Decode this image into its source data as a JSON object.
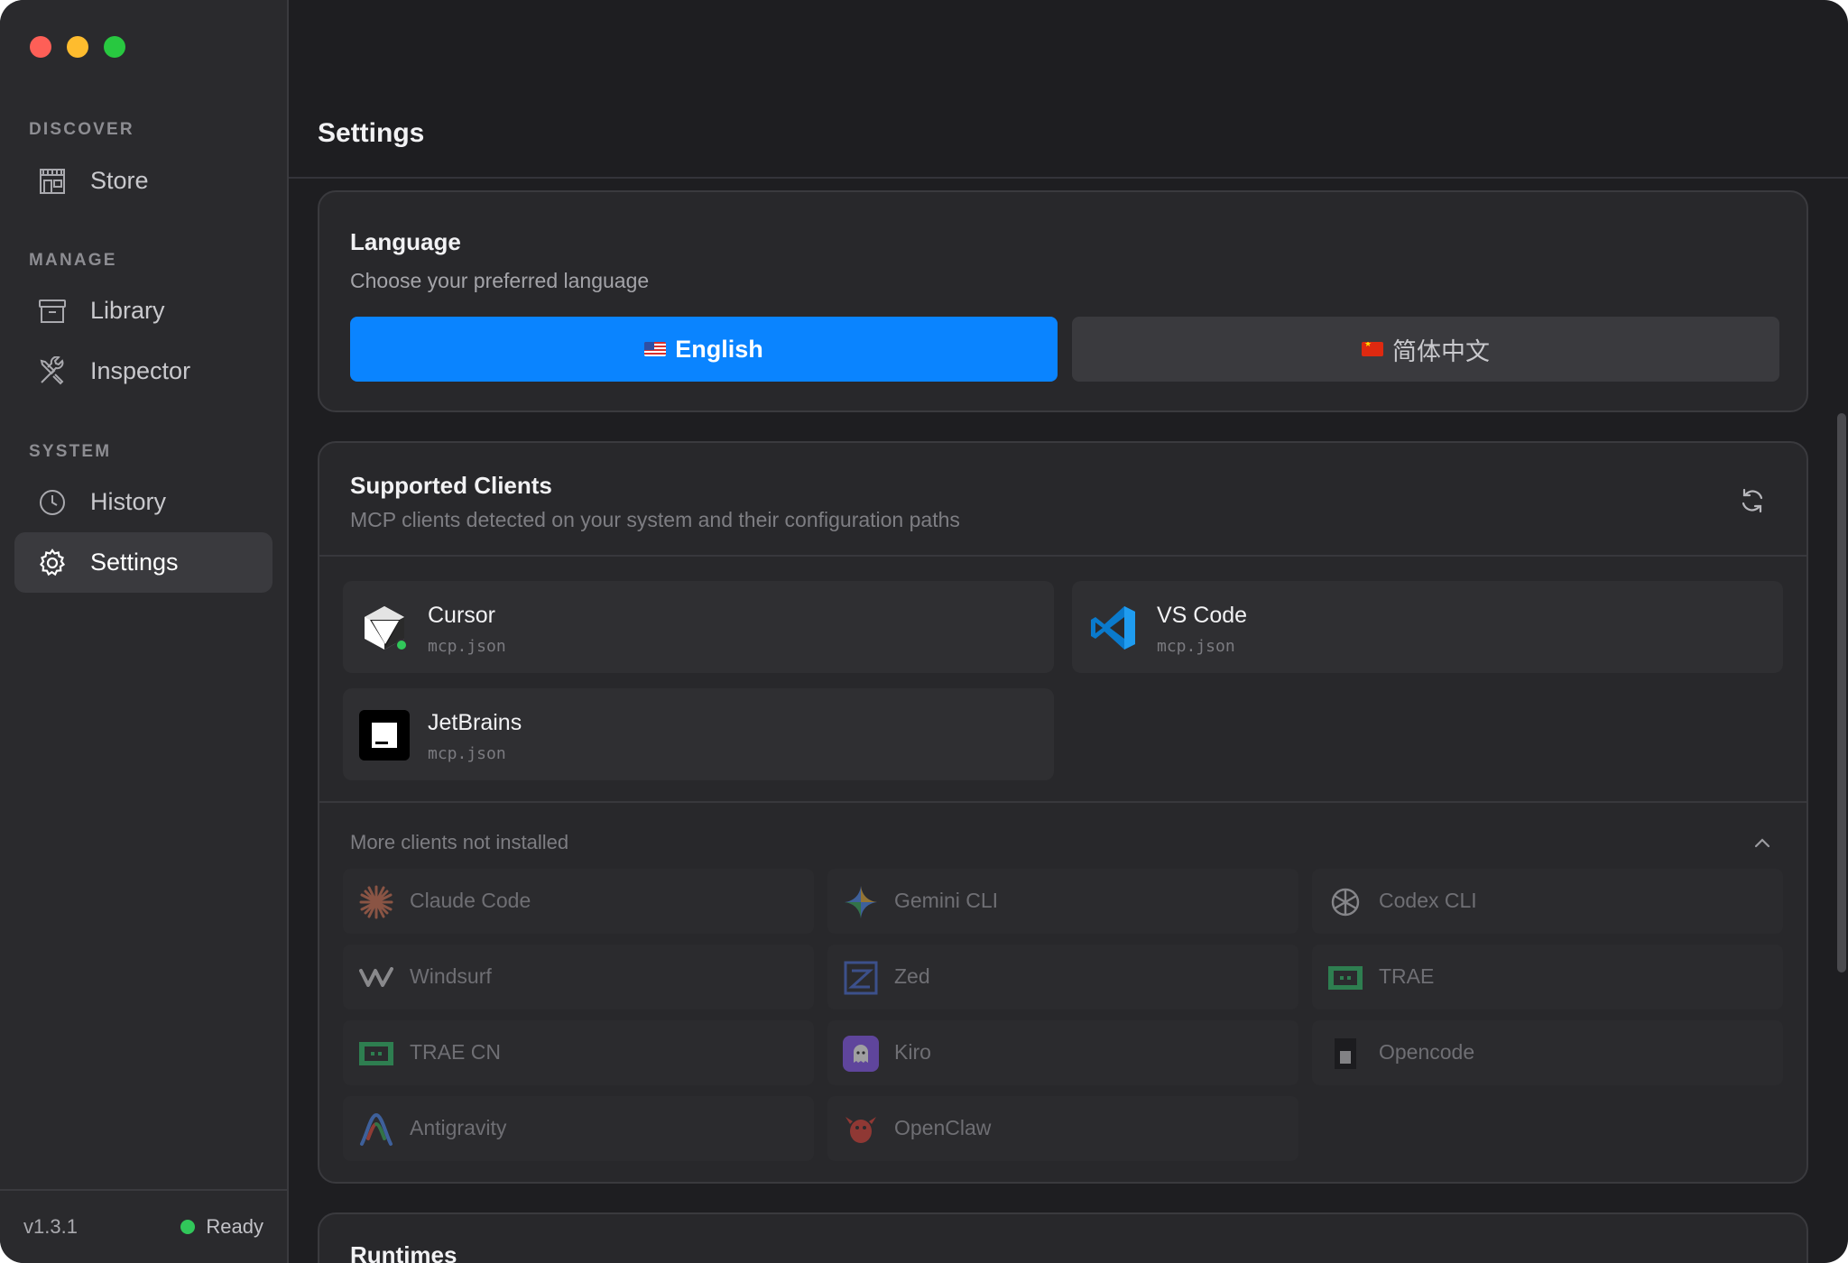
{
  "sidebar": {
    "sections": [
      {
        "label": "DISCOVER",
        "items": [
          {
            "label": "Store",
            "icon": "store-icon"
          }
        ]
      },
      {
        "label": "MANAGE",
        "items": [
          {
            "label": "Library",
            "icon": "archive-box-icon"
          },
          {
            "label": "Inspector",
            "icon": "tools-icon"
          }
        ]
      },
      {
        "label": "SYSTEM",
        "items": [
          {
            "label": "History",
            "icon": "clock-icon"
          },
          {
            "label": "Settings",
            "icon": "gear-icon",
            "active": true
          }
        ]
      }
    ],
    "version": "v1.3.1",
    "status": "Ready"
  },
  "header": {
    "title": "Settings"
  },
  "language": {
    "title": "Language",
    "subtitle": "Choose your preferred language",
    "options": [
      {
        "label": "English",
        "selected": true
      },
      {
        "label": "简体中文",
        "selected": false
      }
    ]
  },
  "clients": {
    "title": "Supported Clients",
    "subtitle": "MCP clients detected on your system and their configuration paths",
    "installed": [
      {
        "name": "Cursor",
        "file": "mcp.json",
        "icon": "cursor-logo-icon",
        "active": true
      },
      {
        "name": "VS Code",
        "file": "mcp.json",
        "icon": "vscode-logo-icon"
      },
      {
        "name": "JetBrains",
        "file": "mcp.json",
        "icon": "jetbrains-logo-icon",
        "logo_text": "JB"
      }
    ],
    "more_label": "More clients not installed",
    "not_installed": [
      {
        "name": "Claude Code",
        "icon": "claude-logo-icon"
      },
      {
        "name": "Gemini CLI",
        "icon": "gemini-logo-icon"
      },
      {
        "name": "Codex CLI",
        "icon": "openai-logo-icon"
      },
      {
        "name": "Windsurf",
        "icon": "windsurf-logo-icon"
      },
      {
        "name": "Zed",
        "icon": "zed-logo-icon"
      },
      {
        "name": "TRAE",
        "icon": "trae-logo-icon"
      },
      {
        "name": "TRAE CN",
        "icon": "trae-cn-logo-icon"
      },
      {
        "name": "Kiro",
        "icon": "kiro-logo-icon"
      },
      {
        "name": "Opencode",
        "icon": "opencode-logo-icon"
      },
      {
        "name": "Antigravity",
        "icon": "antigravity-logo-icon"
      },
      {
        "name": "OpenClaw",
        "icon": "openclaw-logo-icon"
      }
    ]
  },
  "runtimes": {
    "title": "Runtimes"
  },
  "colors": {
    "accent": "#0a84ff",
    "status_ready": "#31c75a",
    "window_bg": "#1e1e21",
    "sidebar_bg": "#2a2a2d",
    "card_bg": "#28282b"
  }
}
